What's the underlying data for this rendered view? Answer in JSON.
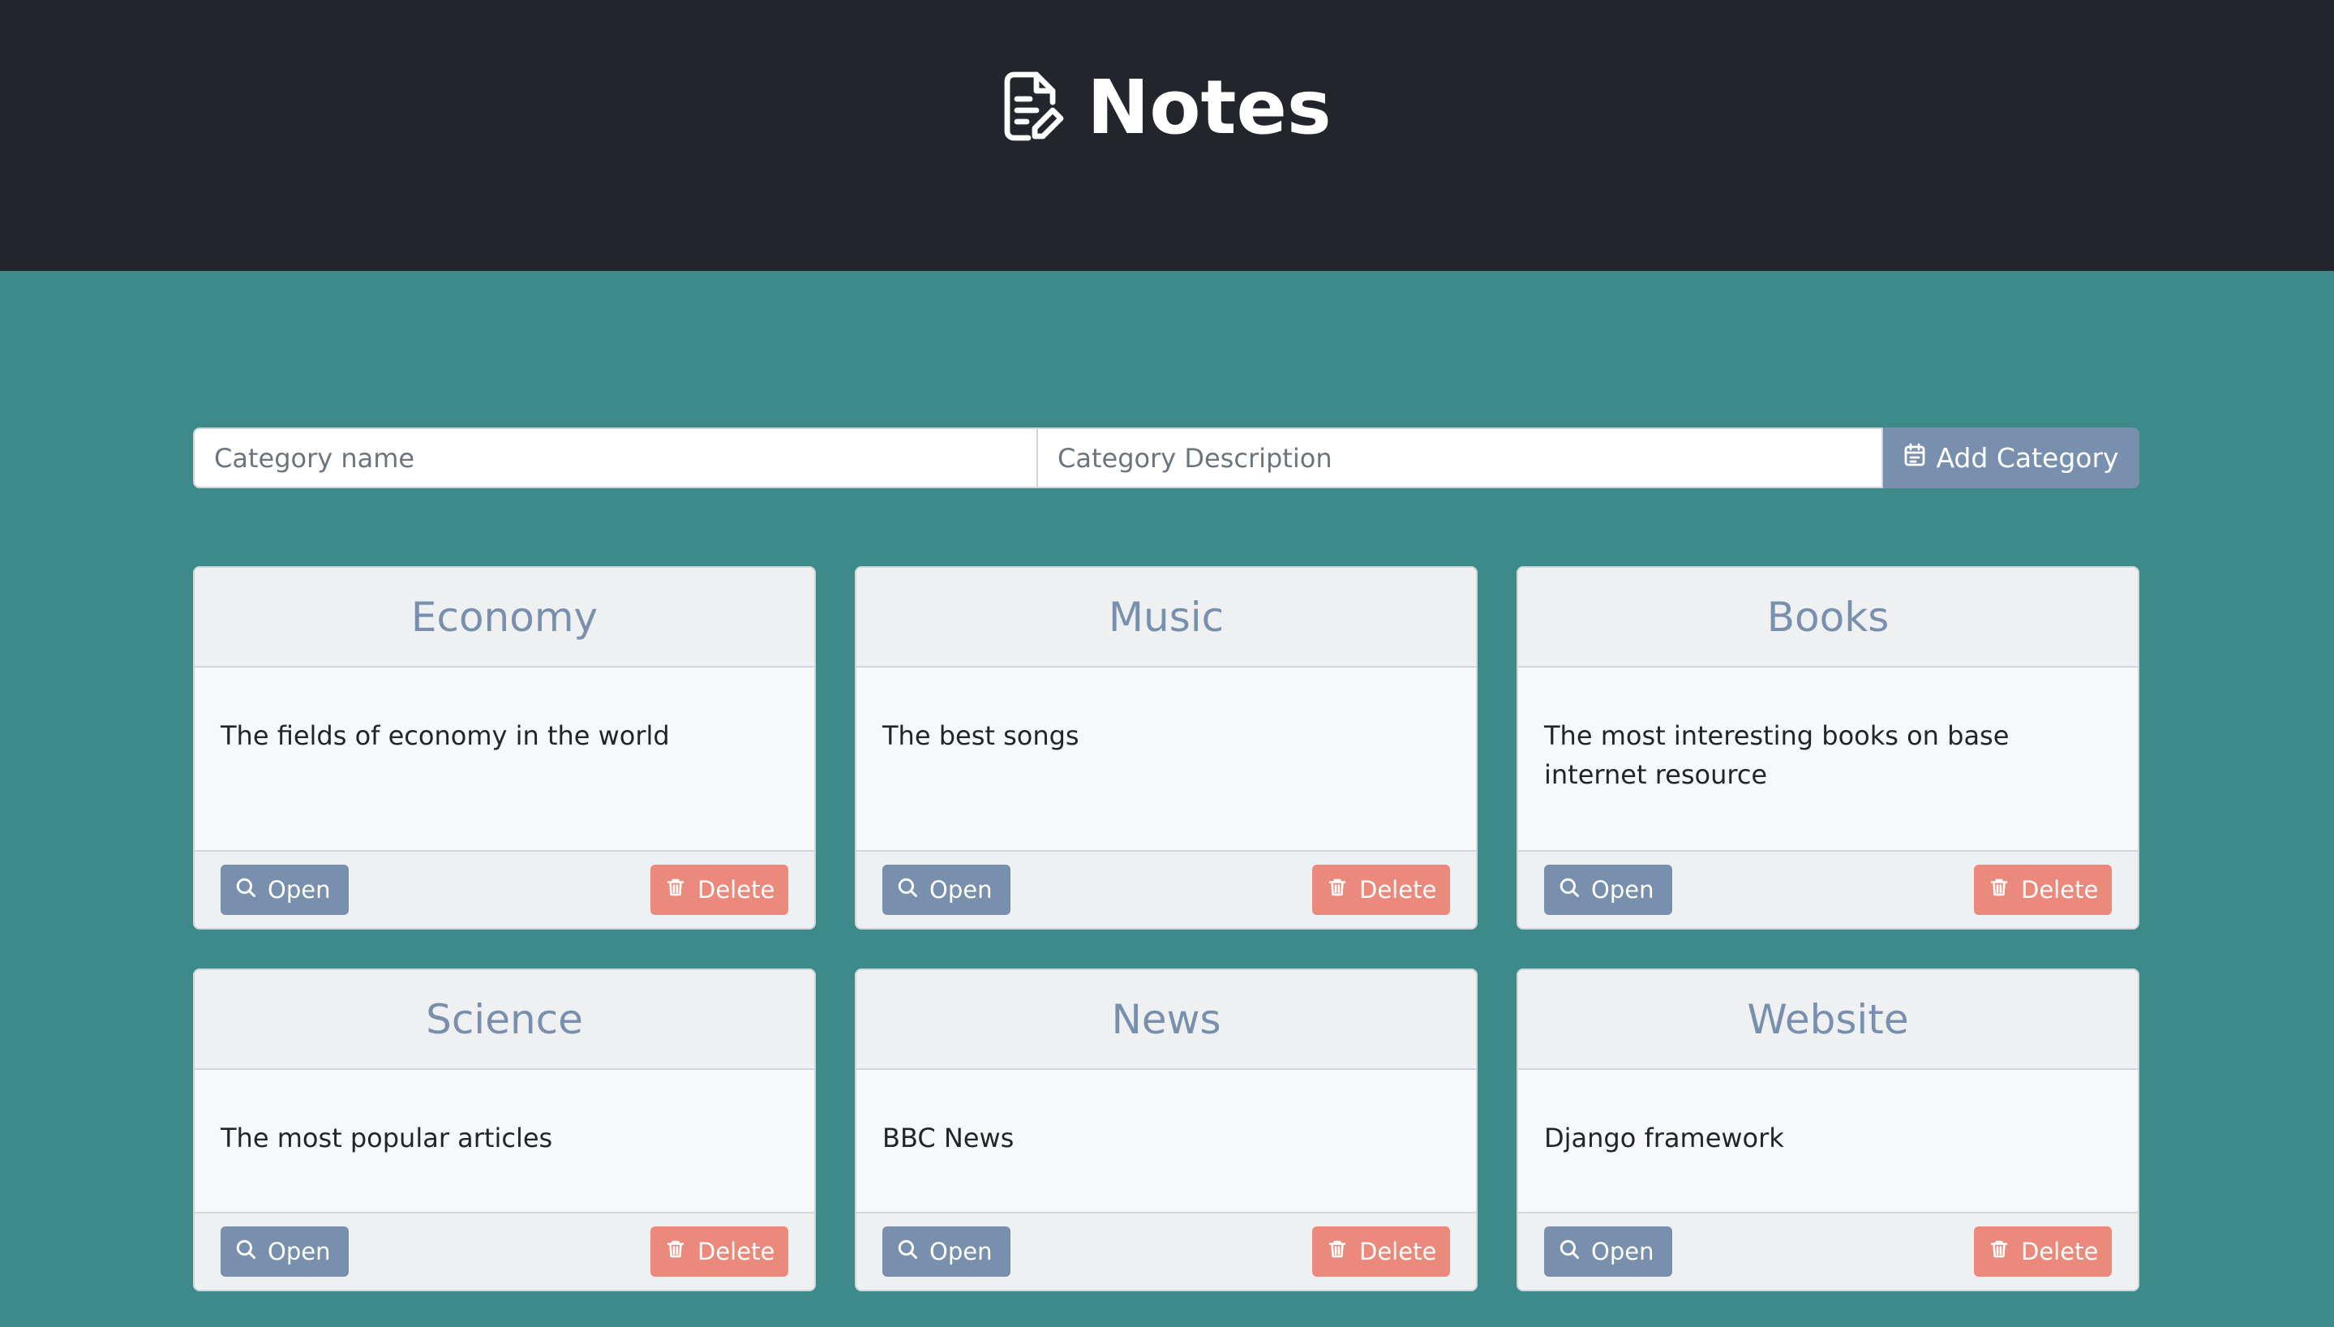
{
  "app": {
    "title": "Notes",
    "icon": "file-edit-icon"
  },
  "form": {
    "name_placeholder": "Category name",
    "name_value": "",
    "description_placeholder": "Category Description",
    "description_value": "",
    "add_label": "Add Category",
    "add_icon": "calendar-icon"
  },
  "colors": {
    "header_bg": "#22252b",
    "page_bg": "#3c8a89",
    "primary": "#7890ad",
    "danger": "#eb8a7c"
  },
  "categories": [
    {
      "title": "Economy",
      "description": "The fields of economy in the world",
      "open_label": "Open",
      "delete_label": "Delete"
    },
    {
      "title": "Music",
      "description": "The best songs",
      "open_label": "Open",
      "delete_label": "Delete"
    },
    {
      "title": "Books",
      "description": "The most interesting books on base internet resource",
      "open_label": "Open",
      "delete_label": "Delete"
    },
    {
      "title": "Science",
      "description": "The most popular articles",
      "open_label": "Open",
      "delete_label": "Delete"
    },
    {
      "title": "News",
      "description": "BBC News",
      "open_label": "Open",
      "delete_label": "Delete"
    },
    {
      "title": "Website",
      "description": "Django framework",
      "open_label": "Open",
      "delete_label": "Delete"
    }
  ]
}
